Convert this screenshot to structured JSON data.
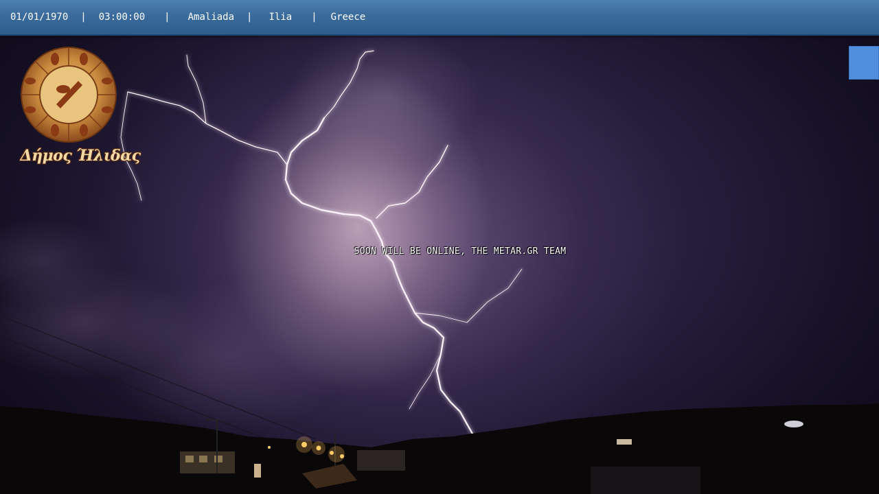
{
  "topbar": {
    "date": "01/01/1970",
    "time": "03:00:00",
    "town": "Amaliada",
    "region": "Ilia",
    "country": "Greece",
    "separator": "|"
  },
  "logo": {
    "text": "Δήμος Ήλιδας",
    "icon": "municipality-seal-icon"
  },
  "overlay": {
    "message": "SOON WILL BE ONLINE, THE METAR.GR TEAM"
  },
  "colors": {
    "bar": "#3a6b9c",
    "button": "#4f8fdc"
  }
}
